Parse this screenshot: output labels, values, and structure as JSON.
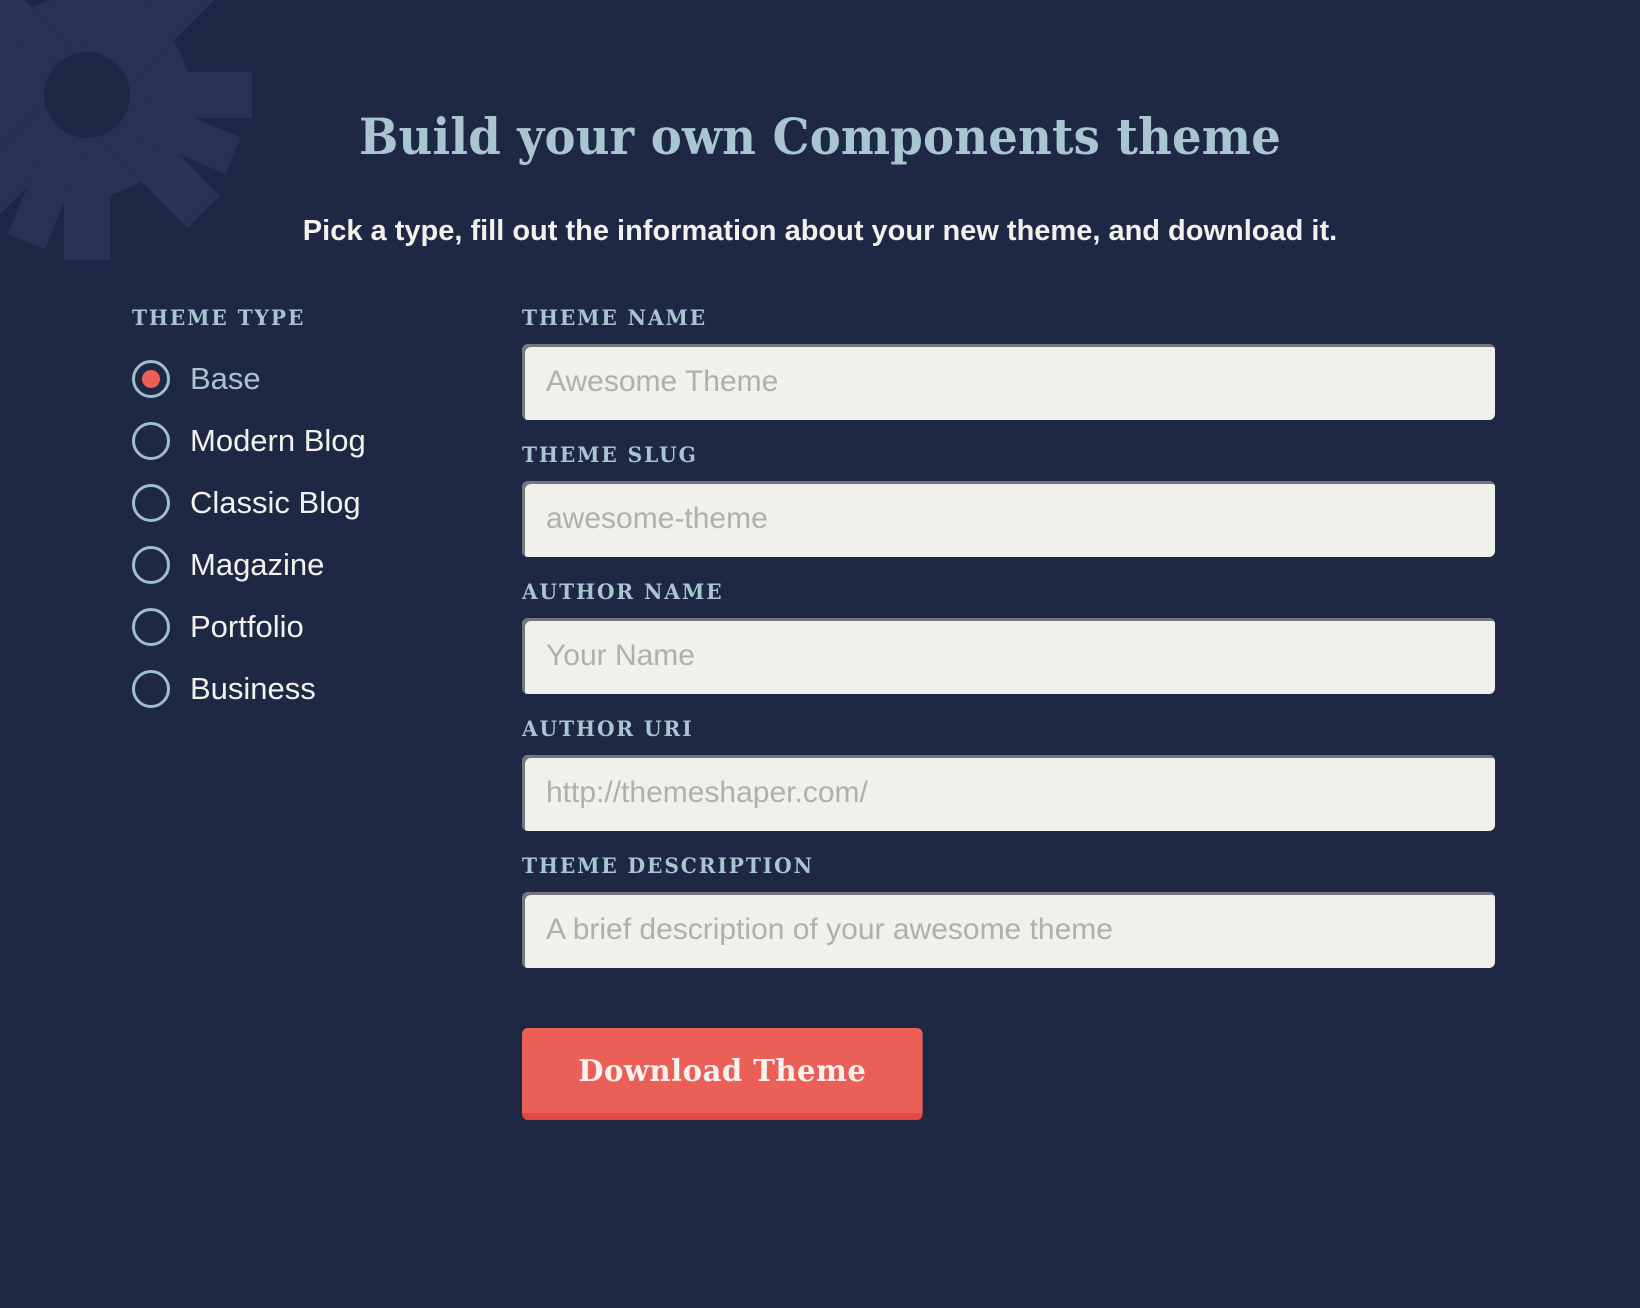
{
  "theme": {
    "bg": "#1e2744",
    "accent_blue": "#a9c6d0",
    "accent_red": "#ec5f57",
    "input_bg": "#f1f0eb",
    "text_light": "#f2f1ec"
  },
  "header": {
    "title": "Build your own Components theme",
    "subtitle": "Pick a type, fill out the information about your new theme, and download it."
  },
  "theme_type": {
    "label": "Theme Type",
    "selected": "Base",
    "options": [
      {
        "label": "Base",
        "selected": true
      },
      {
        "label": "Modern Blog",
        "selected": false
      },
      {
        "label": "Classic Blog",
        "selected": false
      },
      {
        "label": "Magazine",
        "selected": false
      },
      {
        "label": "Portfolio",
        "selected": false
      },
      {
        "label": "Business",
        "selected": false
      }
    ]
  },
  "fields": [
    {
      "label": "Theme Name",
      "value": "",
      "placeholder": "Awesome Theme"
    },
    {
      "label": "Theme Slug",
      "value": "",
      "placeholder": "awesome-theme"
    },
    {
      "label": "Author Name",
      "value": "",
      "placeholder": "Your Name"
    },
    {
      "label": "Author URI",
      "value": "",
      "placeholder": "http://themeshaper.com/"
    },
    {
      "label": "Theme Description",
      "value": "",
      "placeholder": "A brief description of your awesome theme"
    }
  ],
  "actions": {
    "download_label": "Download Theme"
  },
  "decoration": {
    "gear_icon": "gear-icon"
  }
}
